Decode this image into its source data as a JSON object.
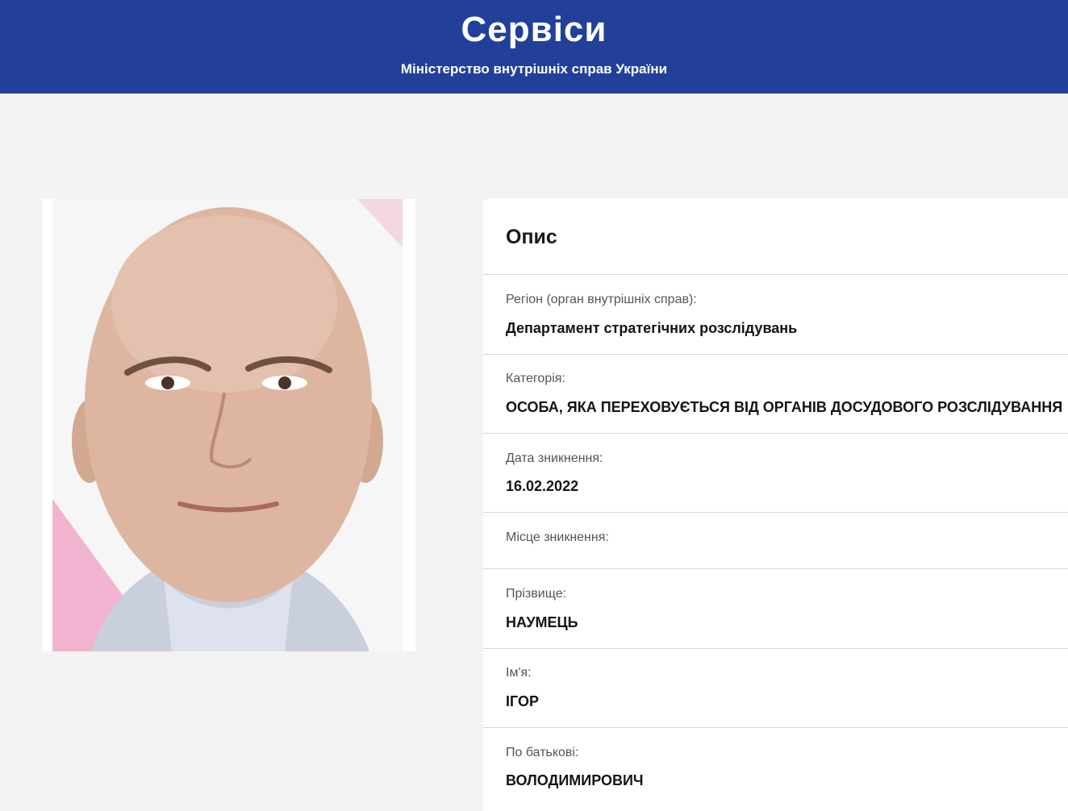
{
  "header": {
    "title": "Сервіси",
    "subtitle": "Міністерство внутрішніх справ України",
    "bg_color": "#22409a"
  },
  "photo": {
    "alt": "person-photo"
  },
  "card": {
    "title": "Опис",
    "fields": [
      {
        "label": "Регіон (орган внутрішніх справ):",
        "value": "Департамент стратегічних розслідувань"
      },
      {
        "label": "Категорія:",
        "value": "ОСОБА, ЯКА ПЕРЕХОВУЄТЬСЯ ВІД ОРГАНІВ ДОСУДОВОГО РОЗСЛІДУВАННЯ"
      },
      {
        "label": "Дата зникнення:",
        "value": "16.02.2022"
      },
      {
        "label": "Місце зникнення:",
        "value": ""
      },
      {
        "label": "Прізвище:",
        "value": "НАУМЕЦЬ"
      },
      {
        "label": "Ім'я:",
        "value": "ІГОР"
      },
      {
        "label": "По батькові:",
        "value": "ВОЛОДИМИРОВИЧ"
      }
    ]
  }
}
